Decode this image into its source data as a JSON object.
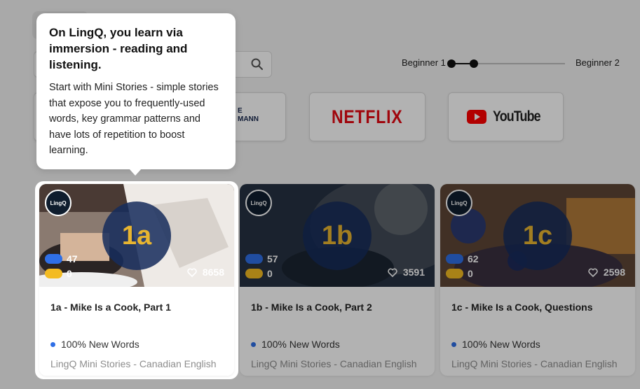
{
  "search": {
    "placeholder": ""
  },
  "level_filter": {
    "min_label": "Beginner 1",
    "max_label": "Beginner 2"
  },
  "providers": [
    {
      "name": "NETFLIX",
      "brand_color": "#e50914"
    },
    {
      "name": "YouTube",
      "brand_color": "#ff0000"
    }
  ],
  "partner_partial": "E\nMANN",
  "tooltip": {
    "title": "On LingQ, you learn via immersion - reading and listening.",
    "body": "Start with Mini Stories - simple stories that expose you to frequently-used words, key grammar patterns and have lots of repetition to boost learning."
  },
  "lessons": [
    {
      "badge": "1a",
      "title": "1a - Mike Is a Cook, Part 1",
      "blue_count": "47",
      "yellow_count": "0",
      "likes": "8658",
      "new_words": "100% New Words",
      "provider": "LingQ Mini Stories - Canadian English",
      "avatar_label": "LingQ"
    },
    {
      "badge": "1b",
      "title": "1b - Mike Is a Cook, Part 2",
      "blue_count": "57",
      "yellow_count": "0",
      "likes": "3591",
      "new_words": "100% New Words",
      "provider": "LingQ Mini Stories - Canadian English",
      "avatar_label": "LingQ"
    },
    {
      "badge": "1c",
      "title": "1c - Mike Is a Cook, Questions",
      "blue_count": "62",
      "yellow_count": "0",
      "likes": "2598",
      "new_words": "100% New Words",
      "provider": "LingQ Mini Stories - Canadian English",
      "avatar_label": "LingQ"
    }
  ],
  "colors": {
    "accent_blue": "#2f6fe6",
    "accent_yellow": "#f3bb22",
    "badge_bg": "#162c5c",
    "badge_text": "#e8b530"
  }
}
